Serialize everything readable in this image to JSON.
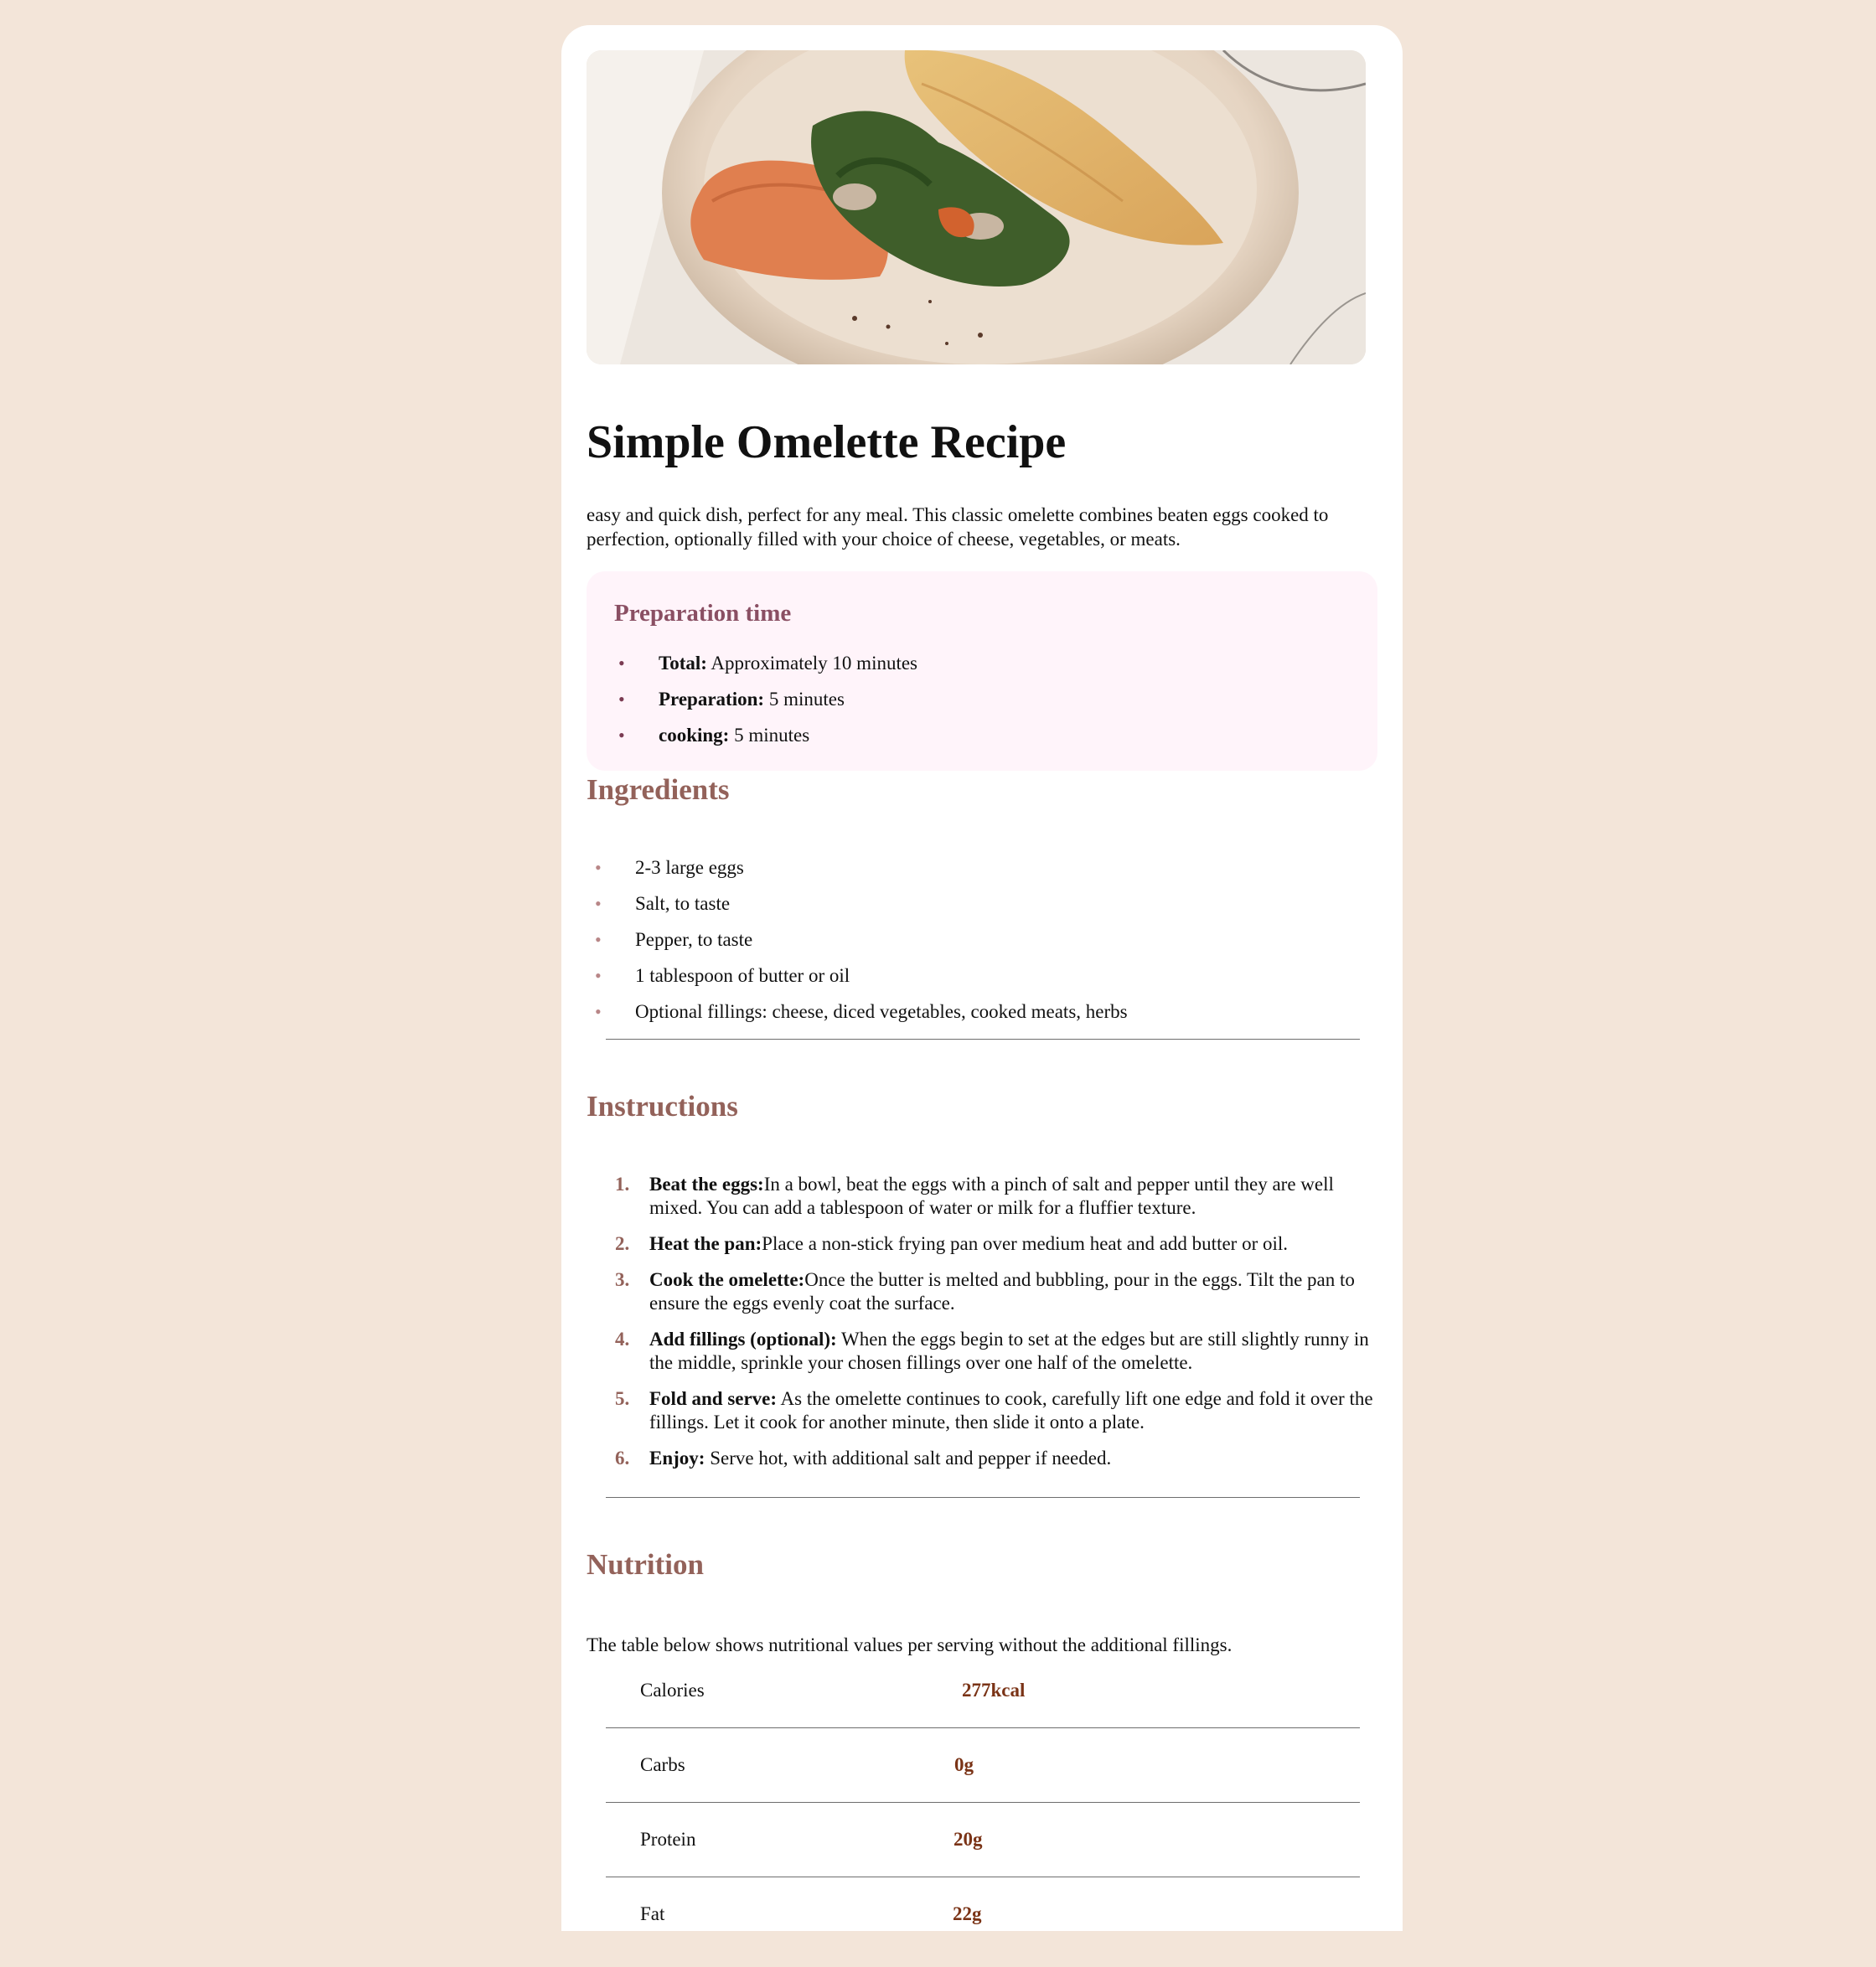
{
  "hero": {
    "alt": "Omelette with spinach, mushrooms and hummus on a plate"
  },
  "recipe": {
    "title": "Simple Omelette Recipe",
    "intro": "easy and quick dish, perfect for any meal. This classic omelette combines beaten eggs cooked to perfection, optionally filled with your choice of cheese, vegetables, or meats."
  },
  "prep": {
    "heading": "Preparation time",
    "items": [
      {
        "label": "Total:",
        "value": " Approximately 10 minutes"
      },
      {
        "label": "Preparation:",
        "value": " 5 minutes"
      },
      {
        "label": "cooking:",
        "value": " 5 minutes"
      }
    ]
  },
  "ingredients": {
    "heading": "Ingredients",
    "items": [
      "2-3 large eggs",
      "Salt, to taste",
      "Pepper, to taste",
      "1 tablespoon of butter or oil",
      "Optional fillings: cheese, diced vegetables, cooked meats, herbs"
    ]
  },
  "instructions": {
    "heading": "Instructions",
    "items": [
      {
        "num": "1.",
        "label": "Beat the eggs:",
        "text": "In a bowl, beat the eggs with a pinch of salt and pepper until they are well mixed. You can add a tablespoon of water or milk for a fluffier texture."
      },
      {
        "num": "2.",
        "label": "Heat the pan:",
        "text": "Place a non-stick frying pan over medium heat and add butter or oil."
      },
      {
        "num": "3.",
        "label": "Cook the omelette:",
        "text": "Once the butter is melted and bubbling, pour in the eggs. Tilt the pan to ensure the eggs evenly coat the surface."
      },
      {
        "num": "4.",
        "label": "Add fillings (optional):",
        "text": " When the eggs begin to set at the edges but are still slightly runny in the middle, sprinkle your chosen fillings over one half of the omelette."
      },
      {
        "num": "5.",
        "label": "Fold and serve:",
        "text": " As the omelette continues to cook, carefully lift one edge and fold it over the fillings. Let it cook for another minute, then slide it onto a plate."
      },
      {
        "num": "6.",
        "label": "Enjoy:",
        "text": " Serve hot, with additional salt and pepper if needed."
      }
    ]
  },
  "nutrition": {
    "heading": "Nutrition",
    "description": "The table below shows nutritional values per serving without the additional fillings.",
    "rows": [
      {
        "label": "Calories",
        "value": "277kcal"
      },
      {
        "label": "Carbs",
        "value": "0g"
      },
      {
        "label": "Protein",
        "value": "20g"
      },
      {
        "label": "Fat",
        "value": "22g"
      }
    ]
  },
  "colors": {
    "page_bg": "#f3e5d9",
    "card_bg": "#ffffff",
    "prep_bg": "#fff4fa",
    "prep_heading": "#8a4f63",
    "section_heading": "#93625a",
    "nutrition_value": "#7a3316"
  }
}
